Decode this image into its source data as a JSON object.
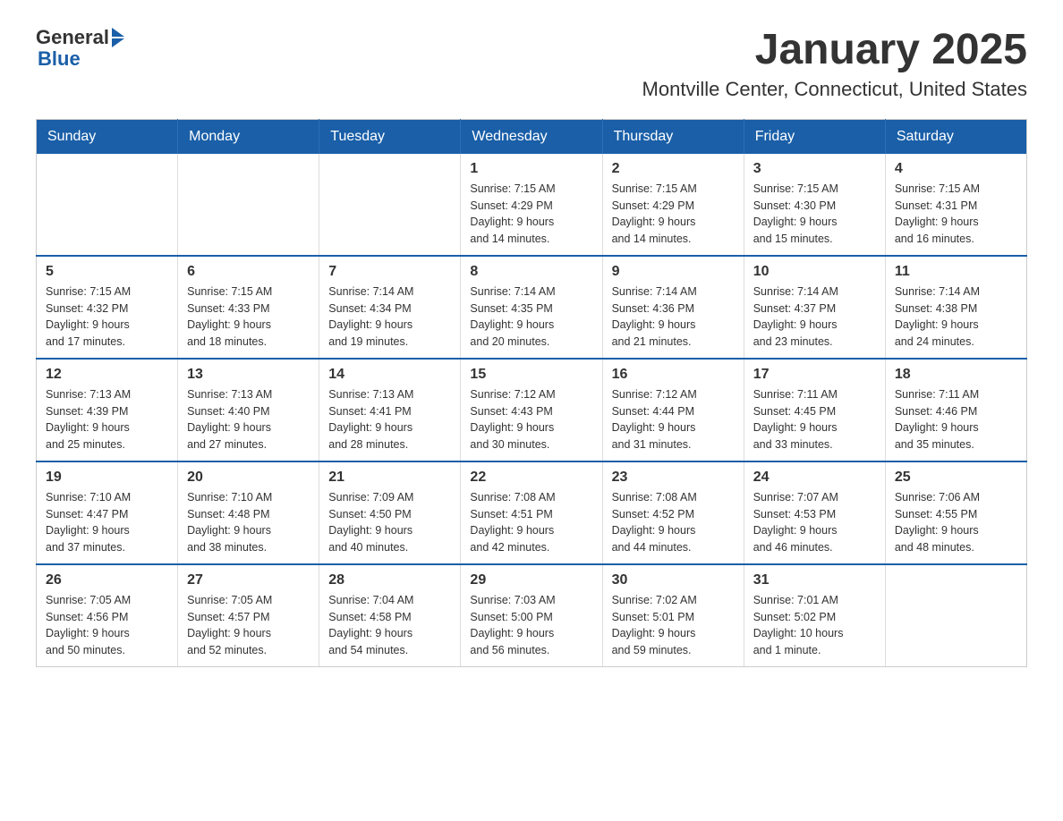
{
  "logo": {
    "general": "General",
    "blue": "Blue"
  },
  "header": {
    "month": "January 2025",
    "location": "Montville Center, Connecticut, United States"
  },
  "weekdays": [
    "Sunday",
    "Monday",
    "Tuesday",
    "Wednesday",
    "Thursday",
    "Friday",
    "Saturday"
  ],
  "weeks": [
    [
      {
        "day": "",
        "info": ""
      },
      {
        "day": "",
        "info": ""
      },
      {
        "day": "",
        "info": ""
      },
      {
        "day": "1",
        "info": "Sunrise: 7:15 AM\nSunset: 4:29 PM\nDaylight: 9 hours\nand 14 minutes."
      },
      {
        "day": "2",
        "info": "Sunrise: 7:15 AM\nSunset: 4:29 PM\nDaylight: 9 hours\nand 14 minutes."
      },
      {
        "day": "3",
        "info": "Sunrise: 7:15 AM\nSunset: 4:30 PM\nDaylight: 9 hours\nand 15 minutes."
      },
      {
        "day": "4",
        "info": "Sunrise: 7:15 AM\nSunset: 4:31 PM\nDaylight: 9 hours\nand 16 minutes."
      }
    ],
    [
      {
        "day": "5",
        "info": "Sunrise: 7:15 AM\nSunset: 4:32 PM\nDaylight: 9 hours\nand 17 minutes."
      },
      {
        "day": "6",
        "info": "Sunrise: 7:15 AM\nSunset: 4:33 PM\nDaylight: 9 hours\nand 18 minutes."
      },
      {
        "day": "7",
        "info": "Sunrise: 7:14 AM\nSunset: 4:34 PM\nDaylight: 9 hours\nand 19 minutes."
      },
      {
        "day": "8",
        "info": "Sunrise: 7:14 AM\nSunset: 4:35 PM\nDaylight: 9 hours\nand 20 minutes."
      },
      {
        "day": "9",
        "info": "Sunrise: 7:14 AM\nSunset: 4:36 PM\nDaylight: 9 hours\nand 21 minutes."
      },
      {
        "day": "10",
        "info": "Sunrise: 7:14 AM\nSunset: 4:37 PM\nDaylight: 9 hours\nand 23 minutes."
      },
      {
        "day": "11",
        "info": "Sunrise: 7:14 AM\nSunset: 4:38 PM\nDaylight: 9 hours\nand 24 minutes."
      }
    ],
    [
      {
        "day": "12",
        "info": "Sunrise: 7:13 AM\nSunset: 4:39 PM\nDaylight: 9 hours\nand 25 minutes."
      },
      {
        "day": "13",
        "info": "Sunrise: 7:13 AM\nSunset: 4:40 PM\nDaylight: 9 hours\nand 27 minutes."
      },
      {
        "day": "14",
        "info": "Sunrise: 7:13 AM\nSunset: 4:41 PM\nDaylight: 9 hours\nand 28 minutes."
      },
      {
        "day": "15",
        "info": "Sunrise: 7:12 AM\nSunset: 4:43 PM\nDaylight: 9 hours\nand 30 minutes."
      },
      {
        "day": "16",
        "info": "Sunrise: 7:12 AM\nSunset: 4:44 PM\nDaylight: 9 hours\nand 31 minutes."
      },
      {
        "day": "17",
        "info": "Sunrise: 7:11 AM\nSunset: 4:45 PM\nDaylight: 9 hours\nand 33 minutes."
      },
      {
        "day": "18",
        "info": "Sunrise: 7:11 AM\nSunset: 4:46 PM\nDaylight: 9 hours\nand 35 minutes."
      }
    ],
    [
      {
        "day": "19",
        "info": "Sunrise: 7:10 AM\nSunset: 4:47 PM\nDaylight: 9 hours\nand 37 minutes."
      },
      {
        "day": "20",
        "info": "Sunrise: 7:10 AM\nSunset: 4:48 PM\nDaylight: 9 hours\nand 38 minutes."
      },
      {
        "day": "21",
        "info": "Sunrise: 7:09 AM\nSunset: 4:50 PM\nDaylight: 9 hours\nand 40 minutes."
      },
      {
        "day": "22",
        "info": "Sunrise: 7:08 AM\nSunset: 4:51 PM\nDaylight: 9 hours\nand 42 minutes."
      },
      {
        "day": "23",
        "info": "Sunrise: 7:08 AM\nSunset: 4:52 PM\nDaylight: 9 hours\nand 44 minutes."
      },
      {
        "day": "24",
        "info": "Sunrise: 7:07 AM\nSunset: 4:53 PM\nDaylight: 9 hours\nand 46 minutes."
      },
      {
        "day": "25",
        "info": "Sunrise: 7:06 AM\nSunset: 4:55 PM\nDaylight: 9 hours\nand 48 minutes."
      }
    ],
    [
      {
        "day": "26",
        "info": "Sunrise: 7:05 AM\nSunset: 4:56 PM\nDaylight: 9 hours\nand 50 minutes."
      },
      {
        "day": "27",
        "info": "Sunrise: 7:05 AM\nSunset: 4:57 PM\nDaylight: 9 hours\nand 52 minutes."
      },
      {
        "day": "28",
        "info": "Sunrise: 7:04 AM\nSunset: 4:58 PM\nDaylight: 9 hours\nand 54 minutes."
      },
      {
        "day": "29",
        "info": "Sunrise: 7:03 AM\nSunset: 5:00 PM\nDaylight: 9 hours\nand 56 minutes."
      },
      {
        "day": "30",
        "info": "Sunrise: 7:02 AM\nSunset: 5:01 PM\nDaylight: 9 hours\nand 59 minutes."
      },
      {
        "day": "31",
        "info": "Sunrise: 7:01 AM\nSunset: 5:02 PM\nDaylight: 10 hours\nand 1 minute."
      },
      {
        "day": "",
        "info": ""
      }
    ]
  ]
}
